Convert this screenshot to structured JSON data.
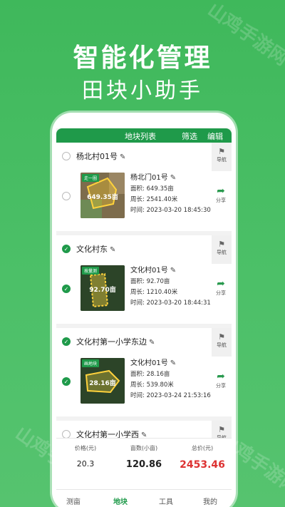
{
  "hero": {
    "headline": "智能化管理",
    "subline": "田块小助手"
  },
  "watermark": "山鸡手游网",
  "app": {
    "header": {
      "title": "地块列表",
      "filter": "筛选",
      "edit": "编辑"
    },
    "plots": [
      {
        "name": "杨北村01号",
        "checked": false,
        "nav_label": "导航",
        "share_label": "分享",
        "thumb_tag": "走一圈",
        "thumb_area": "649.35亩",
        "plot_name": "杨北门01号",
        "area": "面积: 649.35亩",
        "perimeter": "周长: 2541.40米",
        "time": "时间: 2023-03-20 18:45:30"
      },
      {
        "name": "文化村东",
        "checked": true,
        "nav_label": "导航",
        "share_label": "分享",
        "thumb_tag": "按量测",
        "thumb_area": "92.70亩",
        "plot_name": "文化村01号",
        "area": "面积: 92.70亩",
        "perimeter": "周长: 1210.40米",
        "time": "时间: 2023-03-20 18:44:31"
      },
      {
        "name": "文化村第一小学东边",
        "checked": true,
        "nav_label": "导航",
        "share_label": "分享",
        "thumb_tag": "画地块",
        "thumb_area": "28.16亩",
        "plot_name": "文化村01号",
        "area": "面积: 28.16亩",
        "perimeter": "周长: 539.80米",
        "time": "时间: 2023-03-24 21:53:16"
      },
      {
        "name": "文化村第一小学西",
        "checked": false,
        "nav_label": "导航"
      }
    ],
    "summary": {
      "price_label": "价格(元)",
      "price_value": "20.3",
      "mu_label": "亩数(小亩)",
      "mu_value": "120.86",
      "total_label": "总价(元)",
      "total_value": "2453.46"
    },
    "tabs": [
      "测亩",
      "地块",
      "工具",
      "我的"
    ],
    "active_tab": "地块"
  },
  "colors": {
    "brand_green": "#1f9a4a",
    "background_green": "#4cc068",
    "price_red": "#d33333"
  }
}
